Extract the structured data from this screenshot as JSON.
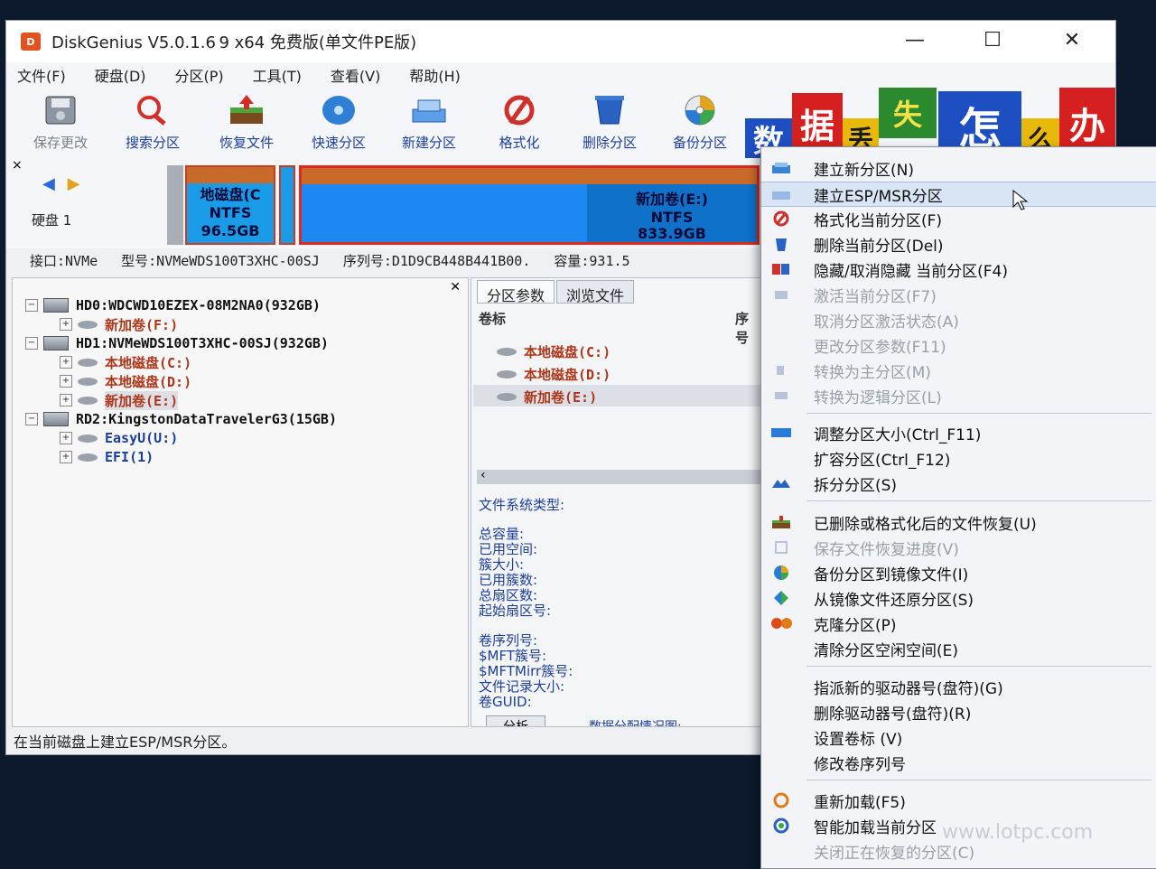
{
  "window": {
    "title": "DiskGenius V5.0.1.6 9 x64 免费版(单文件PE版)",
    "minimize": "—",
    "maximize": "☐",
    "close": "✕"
  },
  "menubar": [
    "文件(F)",
    "硬盘(D)",
    "分区(P)",
    "工具(T)",
    "查看(V)",
    "帮助(H)"
  ],
  "toolbar": {
    "save": "保存更改",
    "search": "搜索分区",
    "recover": "恢复文件",
    "quick": "快速分区",
    "new": "新建分区",
    "format": "格式化",
    "delete": "删除分区",
    "backup": "备份分区"
  },
  "banner": {
    "c1": "数",
    "c2": "据",
    "c3": "丢",
    "c4": "失",
    "c5": "怎",
    "c6": "么",
    "c7": "办",
    "colors": {
      "blue": "#1e4fc2",
      "red": "#d5201f",
      "green": "#2b8a2e",
      "yellow": "#e8b90a"
    }
  },
  "diskbar": {
    "disk_label": "硬盘  1",
    "part_c": {
      "name": "地磁盘(C",
      "fs": "NTFS",
      "size": "96.5GB"
    },
    "part_e": {
      "name": "新加卷(E:)",
      "fs": "NTFS",
      "size": "833.9GB"
    }
  },
  "infobar": {
    "iface": "接口:NVMe",
    "model": "型号:NVMeWDS100T3XHC-00SJ",
    "serial": "序列号:D1D9CB448B441B00.",
    "capacity": "容量:931.5"
  },
  "tree": {
    "hd0": "HD0:WDCWD10EZEX-08M2NA0(932GB)",
    "hd0_p1": "新加卷(F:)",
    "hd1": "HD1:NVMeWDS100T3XHC-00SJ(932GB)",
    "hd1_p1": "本地磁盘(C:)",
    "hd1_p2": "本地磁盘(D:)",
    "hd1_p3": "新加卷(E:)",
    "rd2": "RD2:KingstonDataTravelerG3(15GB)",
    "rd2_p1": "EasyU(U:)",
    "rd2_p2": "EFI(1)"
  },
  "right": {
    "tab1": "分区参数",
    "tab2": "浏览文件",
    "col_vol": "卷标",
    "col_seq": "序号",
    "vols": [
      "本地磁盘(C:)",
      "本地磁盘(D:)",
      "新加卷(E:)"
    ],
    "fs_type": "文件系统类型:",
    "props1": [
      "总容量:",
      "已用空间:",
      "簇大小:",
      "已用簇数:",
      "总扇区数:",
      "起始扇区号:"
    ],
    "props2": [
      "卷序列号:",
      "$MFT簇号:",
      "$MFTMirr簇号:",
      "文件记录大小:",
      "卷GUID:"
    ],
    "analyze": "分析",
    "alloc": "数据分配情况图:"
  },
  "status": "在当前磁盘上建立ESP/MSR分区。",
  "context_menu": [
    {
      "label": "建立新分区(N)",
      "dis": false
    },
    {
      "label": "建立ESP/MSR分区",
      "dis": false
    },
    {
      "label": "格式化当前分区(F)",
      "dis": false
    },
    {
      "label": "删除当前分区(Del)",
      "dis": false
    },
    {
      "label": "隐藏/取消隐藏 当前分区(F4)",
      "dis": false
    },
    {
      "label": "激活当前分区(F7)",
      "dis": true
    },
    {
      "label": "取消分区激活状态(A)",
      "dis": true
    },
    {
      "label": "更改分区参数(F11)",
      "dis": true
    },
    {
      "label": "转换为主分区(M)",
      "dis": true
    },
    {
      "label": "转换为逻辑分区(L)",
      "dis": true
    },
    {
      "label": "调整分区大小(Ctrl_F11)",
      "dis": false
    },
    {
      "label": "扩容分区(Ctrl_F12)",
      "dis": false
    },
    {
      "label": "拆分分区(S)",
      "dis": false
    },
    {
      "label": "已删除或格式化后的文件恢复(U)",
      "dis": false
    },
    {
      "label": "保存文件恢复进度(V)",
      "dis": true
    },
    {
      "label": "备份分区到镜像文件(I)",
      "dis": false
    },
    {
      "label": "从镜像文件还原分区(S)",
      "dis": false
    },
    {
      "label": "克隆分区(P)",
      "dis": false
    },
    {
      "label": "清除分区空闲空间(E)",
      "dis": false
    },
    {
      "label": "指派新的驱动器号(盘符)(G)",
      "dis": false
    },
    {
      "label": "删除驱动器号(盘符)(R)",
      "dis": false
    },
    {
      "label": "设置卷标 (V)",
      "dis": false
    },
    {
      "label": "修改卷序列号",
      "dis": false
    },
    {
      "label": "重新加载(F5)",
      "dis": false
    },
    {
      "label": "智能加载当前分区",
      "dis": false
    },
    {
      "label": "关闭正在恢复的分区(C)",
      "dis": true
    }
  ],
  "watermark": "www.lotpc.com"
}
